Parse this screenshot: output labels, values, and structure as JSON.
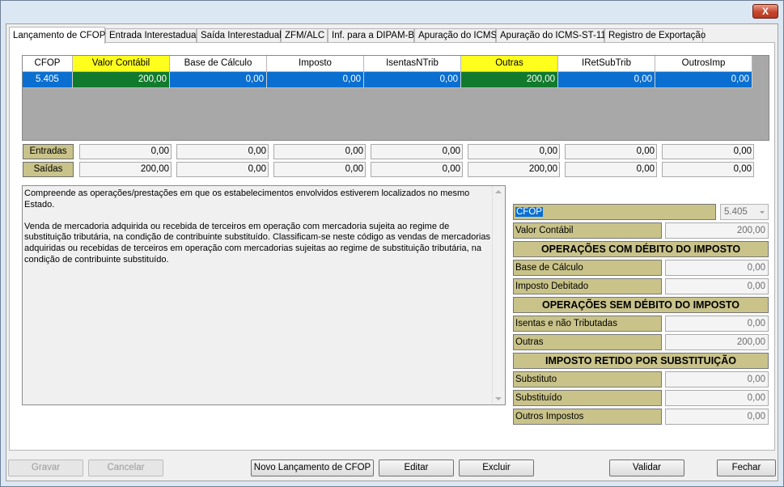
{
  "window": {
    "close_glyph": "X"
  },
  "tabs": [
    "Lançamento de CFOP",
    "Entrada Interestadual",
    "Saída Interestadual",
    "ZFM/ALC",
    "Inf. para a DIPAM-B",
    "Apuração do ICMS",
    "Apuração do ICMS-ST-11",
    "Registro de Exportação"
  ],
  "grid": {
    "columns": [
      "CFOP",
      "Valor Contábil",
      "Base de Cálculo",
      "Imposto",
      "IsentasNTrib",
      "Outras",
      "IRetSubTrib",
      "OutrosImp"
    ],
    "rows": [
      [
        "5.405",
        "200,00",
        "0,00",
        "0,00",
        "0,00",
        "200,00",
        "0,00",
        "0,00"
      ]
    ]
  },
  "totals": {
    "entradas": {
      "label": "Entradas",
      "values": [
        "0,00",
        "0,00",
        "0,00",
        "0,00",
        "0,00",
        "0,00",
        "0,00"
      ]
    },
    "saidas": {
      "label": "Saídas",
      "values": [
        "200,00",
        "0,00",
        "0,00",
        "0,00",
        "200,00",
        "0,00",
        "0,00"
      ]
    }
  },
  "description": {
    "p1": "Compreende as operações/prestações em que os estabelecimentos envolvidos estiverem localizados no mesmo Estado.",
    "p2": "Venda de mercadoria adquirida ou recebida de terceiros em operação com mercadoria sujeita ao regime de substituição tributária, na condição de contribuinte substituído. Classificam-se neste código as vendas de mercadorias adquiridas ou recebidas de terceiros em operação com mercadorias sujeitas ao regime de substituição tributária, na condição de contribuinte substituído."
  },
  "detail": {
    "cfop_label": "CFOP",
    "cfop_value": "5.405",
    "valor_contabil_label": "Valor Contábil",
    "valor_contabil": "200,00",
    "section_debito": "OPERAÇÕES COM DÉBITO DO IMPOSTO",
    "base_calculo_label": "Base de Cálculo",
    "base_calculo": "0,00",
    "imposto_debitado_label": "Imposto Debitado",
    "imposto_debitado": "0,00",
    "section_sem_debito": "OPERAÇÕES SEM DÉBITO DO IMPOSTO",
    "isentas_label": "Isentas e não Tributadas",
    "isentas": "0,00",
    "outras_label": "Outras",
    "outras": "200,00",
    "section_retido": "IMPOSTO RETIDO POR SUBSTITUIÇÃO",
    "substituto_label": "Substituto",
    "substituto": "0,00",
    "substituido_label": "Substituído",
    "substituido": "0,00",
    "outros_impostos_label": "Outros Impostos",
    "outros_impostos": "0,00"
  },
  "buttons": {
    "gravar": "Gravar",
    "cancelar": "Cancelar",
    "novo": "Novo Lançamento de CFOP",
    "editar": "Editar",
    "excluir": "Excluir",
    "validar": "Validar",
    "fechar": "Fechar"
  },
  "colors": {
    "header_highlight": "#ffff1e",
    "row_selected": "#0a6fd0",
    "cell_highlight": "#127a2c",
    "label_bg": "#c9c38a"
  }
}
